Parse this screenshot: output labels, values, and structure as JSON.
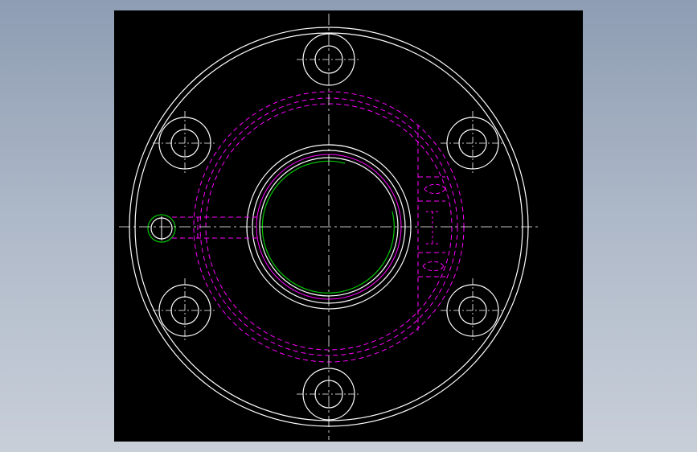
{
  "drawing": {
    "background_color": "#000000",
    "line_colors": {
      "outline": "#ffffff",
      "hidden": "#ff00ff",
      "arc": "#00c800"
    }
  }
}
